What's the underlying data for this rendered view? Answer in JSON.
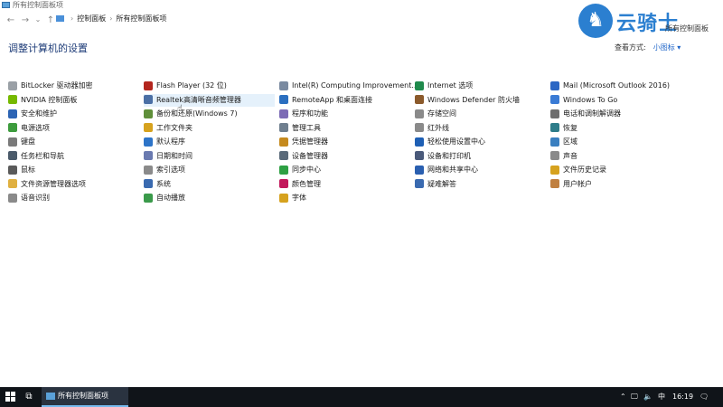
{
  "window": {
    "title": "所有控制面板项"
  },
  "nav": {
    "back": "←",
    "forward": "→",
    "recent": "⌄",
    "up": "↑",
    "breadcrumb": [
      "控制面板",
      "所有控制面板项"
    ],
    "breadcrumb_sep": "›"
  },
  "logo": {
    "glyph": "♞",
    "text": "云骑士",
    "sub": "所有控制面板"
  },
  "heading": "调整计算机的设置",
  "viewby": {
    "label": "查看方式:",
    "value": "小图标 ▾"
  },
  "items": [
    {
      "label": "BitLocker 驱动器加密",
      "color": "#9aa0a6"
    },
    {
      "label": "Flash Player (32 位)",
      "color": "#b3261e"
    },
    {
      "label": "Intel(R) Computing Improvement...",
      "color": "#7a8aa0"
    },
    {
      "label": "Internet 选项",
      "color": "#1f8a4c"
    },
    {
      "label": "Mail (Microsoft Outlook 2016)",
      "color": "#2c67c4"
    },
    {
      "label": "NVIDIA 控制面板",
      "color": "#76b900"
    },
    {
      "label": "Realtek高清晰音频管理器",
      "color": "#4a6fa5"
    },
    {
      "label": "RemoteApp 和桌面连接",
      "color": "#2b6fc0"
    },
    {
      "label": "Windows Defender 防火墙",
      "color": "#8b5a2b"
    },
    {
      "label": "Windows To Go",
      "color": "#3a7bd5"
    },
    {
      "label": "安全和维护",
      "color": "#2c64b4"
    },
    {
      "label": "备份和还原(Windows 7)",
      "color": "#5f8f3a"
    },
    {
      "label": "程序和功能",
      "color": "#7c6bb5"
    },
    {
      "label": "存储空间",
      "color": "#8a8a8a"
    },
    {
      "label": "电话和调制解调器",
      "color": "#6e6e6e"
    },
    {
      "label": "电源选项",
      "color": "#3d9c3d"
    },
    {
      "label": "工作文件夹",
      "color": "#d6a21e"
    },
    {
      "label": "管理工具",
      "color": "#6f7f8f"
    },
    {
      "label": "红外线",
      "color": "#8a8a8a"
    },
    {
      "label": "恢复",
      "color": "#2e7d8a"
    },
    {
      "label": "键盘",
      "color": "#7a7a7a"
    },
    {
      "label": "默认程序",
      "color": "#2d74c8"
    },
    {
      "label": "凭据管理器",
      "color": "#c58a1e"
    },
    {
      "label": "轻松使用设置中心",
      "color": "#1e5fb4"
    },
    {
      "label": "区域",
      "color": "#3a7fc0"
    },
    {
      "label": "任务栏和导航",
      "color": "#4a5a6a"
    },
    {
      "label": "日期和时间",
      "color": "#6a7ab0"
    },
    {
      "label": "设备管理器",
      "color": "#5a6a7a"
    },
    {
      "label": "设备和打印机",
      "color": "#4a5a7a"
    },
    {
      "label": "声音",
      "color": "#8a8a8a"
    },
    {
      "label": "鼠标",
      "color": "#5a5a5a"
    },
    {
      "label": "索引选项",
      "color": "#8a8a8a"
    },
    {
      "label": "同步中心",
      "color": "#2ea043"
    },
    {
      "label": "网络和共享中心",
      "color": "#2a5fb0"
    },
    {
      "label": "文件历史记录",
      "color": "#d6a21e"
    },
    {
      "label": "文件资源管理器选项",
      "color": "#e0b040"
    },
    {
      "label": "系统",
      "color": "#3a6ab0"
    },
    {
      "label": "颜色管理",
      "color": "#c2185b"
    },
    {
      "label": "疑难解答",
      "color": "#3a6ab0"
    },
    {
      "label": "用户帐户",
      "color": "#c08040"
    },
    {
      "label": "语音识别",
      "color": "#8a8a8a"
    },
    {
      "label": "自动播放",
      "color": "#3a9a4a"
    },
    {
      "label": "字体",
      "color": "#d6a21e"
    }
  ],
  "taskbar": {
    "app_label": "所有控制面板项",
    "tray_up": "⌃",
    "tray_lang": "中",
    "time": "16:19"
  }
}
